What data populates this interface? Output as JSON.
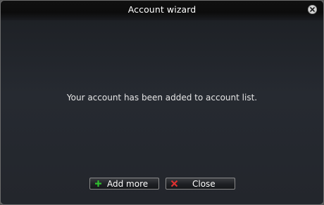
{
  "dialog": {
    "title": "Account wizard",
    "message": "Your account has been added to account list."
  },
  "buttons": {
    "add_more": {
      "label": "Add more",
      "icon": "plus-icon",
      "icon_color": "#2fbf2f"
    },
    "close": {
      "label": "Close",
      "icon": "x-icon",
      "icon_color": "#e03030"
    }
  },
  "colors": {
    "titlebar": "#0e0e0e",
    "body": "#23262c",
    "text": "#e6e6e6"
  }
}
